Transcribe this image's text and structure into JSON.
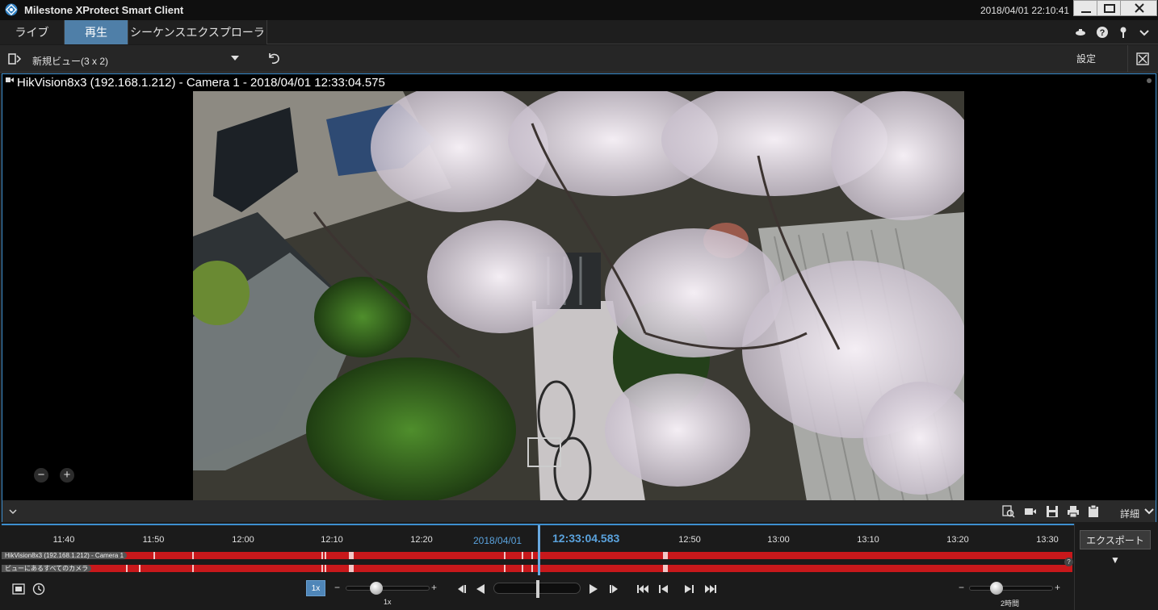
{
  "app": {
    "title": "Milestone XProtect Smart Client",
    "clock": "2018/04/01 22:10:41"
  },
  "tabs": [
    {
      "label": "ライブ",
      "active": false
    },
    {
      "label": "再生",
      "active": true
    },
    {
      "label": "シーケンスエクスプローラ",
      "active": false
    }
  ],
  "toolbar": {
    "view_name": "新規ビュー(3 x 2)",
    "settings_label": "設定"
  },
  "camera": {
    "title": "HikVision8x3 (192.168.1.212) - Camera 1 - 2018/04/01 12:33:04.575",
    "detail_label": "詳細",
    "zoom_out": "−",
    "zoom_in": "+"
  },
  "timeline": {
    "ticks": [
      "11:40",
      "11:50",
      "12:00",
      "12:10",
      "12:20",
      "12:50",
      "13:00",
      "13:10",
      "13:20",
      "13:30"
    ],
    "date": "2018/04/01",
    "current_time": "12:33:04.583",
    "tracks": [
      {
        "label": "HikVision8x3 (192.168.1.212) - Camera 1"
      },
      {
        "label": "ビューにあるすべてのカメラ"
      }
    ],
    "help_badge": "?"
  },
  "export": {
    "label": "エクスポート ▼"
  },
  "playback": {
    "speed_badge": "1x",
    "speed_label": "1x",
    "span_label": "2時間",
    "minus": "−",
    "plus": "+"
  },
  "colors": {
    "accent": "#3d8fcf",
    "active_tab": "#4f7fa8",
    "recording": "#c8181b",
    "time_text": "#5aa2dc"
  }
}
